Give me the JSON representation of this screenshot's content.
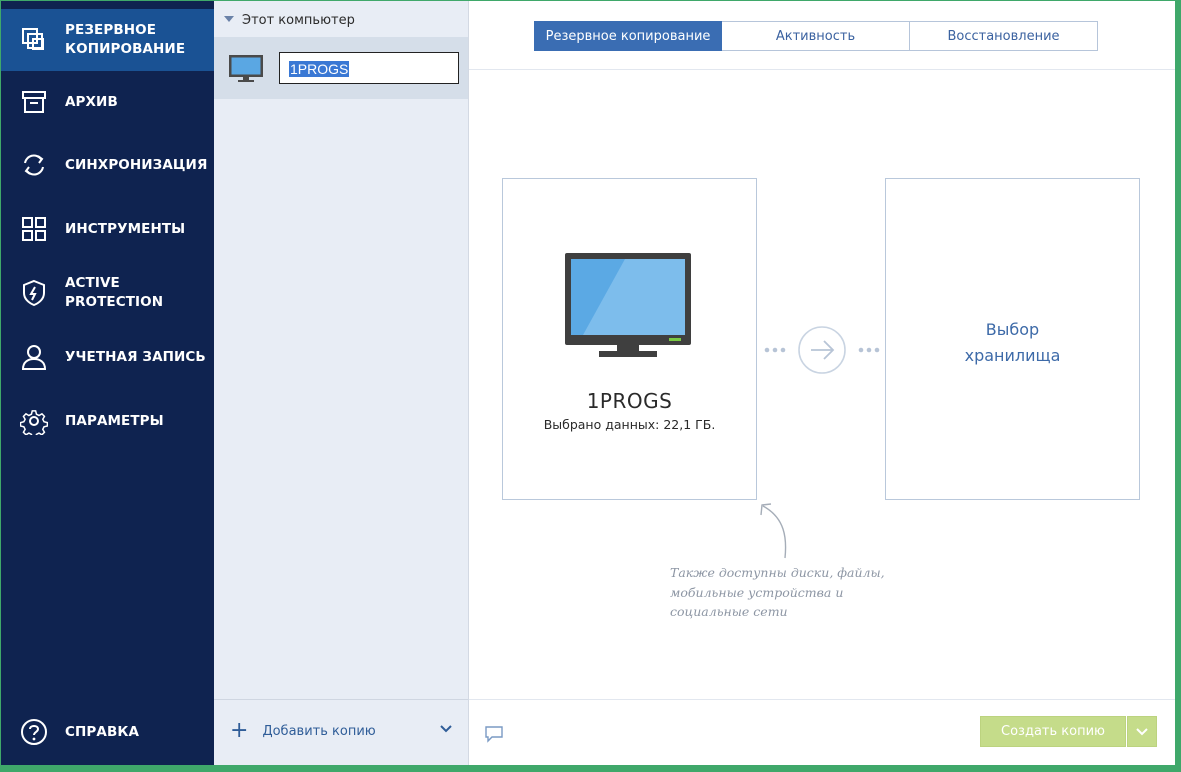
{
  "nav": {
    "items": [
      {
        "label": "РЕЗЕРВНОЕ\nКОПИРОВАНИЕ",
        "icon": "backup-icon",
        "active": true
      },
      {
        "label": "АРХИВ",
        "icon": "archive-icon"
      },
      {
        "label": "СИНХРОНИЗАЦИЯ",
        "icon": "sync-icon"
      },
      {
        "label": "ИНСТРУМЕНТЫ",
        "icon": "tools-grid-icon"
      },
      {
        "label": "ACTIVE\nPROTECTION",
        "icon": "shield-icon"
      },
      {
        "label": "УЧЕТНАЯ ЗАПИСЬ",
        "icon": "account-icon"
      },
      {
        "label": "ПАРАМЕТРЫ",
        "icon": "settings-gear-icon"
      }
    ],
    "help": {
      "label": "СПРАВКА",
      "icon": "help-icon"
    }
  },
  "source_panel": {
    "header": "Этот компьютер",
    "item": {
      "name_value": "1PROGS",
      "icon": "computer-icon"
    },
    "add_copy_label": "Добавить копию"
  },
  "tabs": [
    {
      "label": "Резервное копирование",
      "active": true
    },
    {
      "label": "Активность"
    },
    {
      "label": "Восстановление"
    }
  ],
  "source_card": {
    "title": "1PROGS",
    "subtitle": "Выбрано данных: 22,1 ГБ."
  },
  "destination_card": {
    "label": "Выбор\nхранилища"
  },
  "hint": "Также доступны диски, файлы,\nмобильные устройства и\nсоциальные сети",
  "footer": {
    "create_button": "Создать копию"
  },
  "colors": {
    "nav_bg": "#0f2350",
    "nav_active": "#1a5294",
    "accent": "#3a6db3",
    "create_button": "#c5dc8a",
    "window_border": "#3fa86a"
  }
}
